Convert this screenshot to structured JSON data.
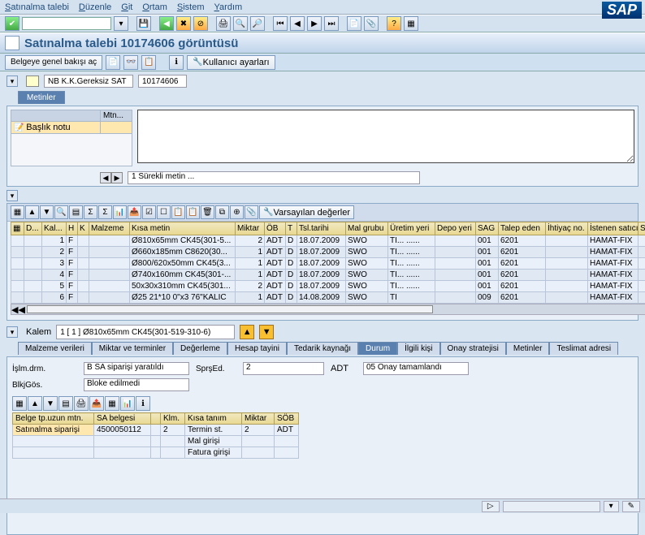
{
  "menu": {
    "items": [
      "Satınalma talebi",
      "Düzenle",
      "Git",
      "Ortam",
      "Sistem",
      "Yardım"
    ]
  },
  "title": "Satınalma talebi 10174606 görüntüsü",
  "apptb": {
    "overview": "Belgeye genel bakışı aç",
    "user_settings": "Kullanıcı ayarları"
  },
  "doc": {
    "type": "NB K.K.Gereksiz SAT",
    "number": "10174606",
    "header_tab": "Metinler"
  },
  "notes": {
    "col": "Mtn...",
    "row": "Başlık notu",
    "continuous": "1 Sürekli metin ..."
  },
  "grid": {
    "defaults": "Varsayılan değerler",
    "cols": [
      "D...",
      "Kal...",
      "H",
      "K",
      "Malzeme",
      "Kısa metin",
      "Miktar",
      "ÖB",
      "T",
      "Tsl.tarihi",
      "Mal grubu",
      "Üretim yeri",
      "Depo yeri",
      "SAG",
      "Talep eden",
      "İhtiyaç no.",
      "İstenen satıcı",
      "Sabit satıcı"
    ],
    "rows": [
      {
        "d": "",
        "kal": "1",
        "h": "F",
        "k": "",
        "mat": "",
        "txt": "Ø810x65mm CK45(301-5...",
        "qty": "2",
        "ob": "ADT",
        "t": "D",
        "date": "18.07.2009",
        "grp": "SWO",
        "uy": "TI... ......",
        "dy": "",
        "sag": "001",
        "req": "6201",
        "need": "",
        "ven": "HAMAT-FIX"
      },
      {
        "d": "",
        "kal": "2",
        "h": "F",
        "k": "",
        "mat": "",
        "txt": "Ø660x185mm C8620(30...",
        "qty": "1",
        "ob": "ADT",
        "t": "D",
        "date": "18.07.2009",
        "grp": "SWO",
        "uy": "TI... ......",
        "dy": "",
        "sag": "001",
        "req": "6201",
        "need": "",
        "ven": "HAMAT-FIX"
      },
      {
        "d": "",
        "kal": "3",
        "h": "F",
        "k": "",
        "mat": "",
        "txt": "Ø800/620x50mm CK45(3...",
        "qty": "1",
        "ob": "ADT",
        "t": "D",
        "date": "18.07.2009",
        "grp": "SWO",
        "uy": "TI... ......",
        "dy": "",
        "sag": "001",
        "req": "6201",
        "need": "",
        "ven": "HAMAT-FIX"
      },
      {
        "d": "",
        "kal": "4",
        "h": "F",
        "k": "",
        "mat": "",
        "txt": "Ø740x160mm CK45(301-...",
        "qty": "1",
        "ob": "ADT",
        "t": "D",
        "date": "18.07.2009",
        "grp": "SWO",
        "uy": "TI... ......",
        "dy": "",
        "sag": "001",
        "req": "6201",
        "need": "",
        "ven": "HAMAT-FIX"
      },
      {
        "d": "",
        "kal": "5",
        "h": "F",
        "k": "",
        "mat": "",
        "txt": "50x30x310mm CK45(301...",
        "qty": "2",
        "ob": "ADT",
        "t": "D",
        "date": "18.07.2009",
        "grp": "SWO",
        "uy": "TI... ......",
        "dy": "",
        "sag": "001",
        "req": "6201",
        "need": "",
        "ven": "HAMAT-FIX"
      },
      {
        "d": "",
        "kal": "6",
        "h": "F",
        "k": "",
        "mat": "",
        "txt": "Ø25 21*10 0\"x3 76\"KALIC",
        "qty": "1",
        "ob": "ADT",
        "t": "D",
        "date": "14.08.2009",
        "grp": "SWO",
        "uy": "TI",
        "dy": "",
        "sag": "009",
        "req": "6201",
        "need": "",
        "ven": "HAMAT-FIX"
      }
    ]
  },
  "item": {
    "label": "Kalem",
    "selected": "1 [ 1 ] Ø810x65mm CK45(301-519-310-6)"
  },
  "subtabs": [
    "Malzeme verileri",
    "Miktar ve terminler",
    "Değerleme",
    "Hesap tayini",
    "Tedarik kaynağı",
    "Durum",
    "İlgili kişi",
    "Onay stratejisi",
    "Metinler",
    "Teslimat adresi"
  ],
  "subtab_active": 5,
  "status": {
    "islm_label": "İşlm.drm.",
    "islm_val": "B SA siparişi yaratıldı",
    "sprs_label": "SprşEd.",
    "sprs_val": "2",
    "sprs_unit": "ADT",
    "onay_val": "05 Onay tamamlandı",
    "blk_label": "BlkjGös.",
    "blk_val": "Bloke edilmedi"
  },
  "subgrid": {
    "cols": [
      "Belge tp.uzun mtn.",
      "SA belgesi",
      "",
      "Klm.",
      "Kısa tanım",
      "Miktar",
      "SÖB"
    ],
    "rows": [
      {
        "c0": "Satınalma siparişi",
        "c1": "4500050112",
        "c2": "",
        "c3": "2",
        "c4": "Termin st.",
        "c5": "2",
        "c6": "ADT"
      },
      {
        "c0": "",
        "c1": "",
        "c2": "",
        "c3": "",
        "c4": "Mal girişi",
        "c5": "",
        "c6": ""
      },
      {
        "c0": "",
        "c1": "",
        "c2": "",
        "c3": "",
        "c4": "Fatura girişi",
        "c5": "",
        "c6": ""
      }
    ]
  },
  "sap": "SAP"
}
